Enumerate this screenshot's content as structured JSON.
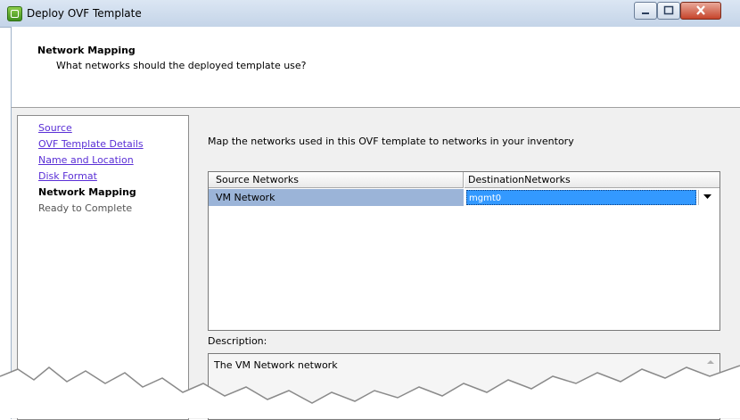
{
  "window": {
    "title": "Deploy OVF Template",
    "controls": [
      "minimize",
      "maximize",
      "close"
    ]
  },
  "header": {
    "title": "Network Mapping",
    "subtitle": "What networks should the deployed template use?"
  },
  "steps": [
    {
      "label": "Source",
      "state": "link"
    },
    {
      "label": "OVF Template Details",
      "state": "link"
    },
    {
      "label": "Name and Location",
      "state": "link"
    },
    {
      "label": "Disk Format",
      "state": "link"
    },
    {
      "label": "Network Mapping",
      "state": "current"
    },
    {
      "label": "Ready to Complete",
      "state": "pending"
    }
  ],
  "main": {
    "intro": "Map the networks used in this OVF template to networks in your inventory",
    "table": {
      "columns": [
        "Source Networks",
        "DestinationNetworks"
      ],
      "rows": [
        {
          "source": "VM Network",
          "destination": "mgmt0"
        }
      ]
    },
    "description_label": "Description:",
    "description_text": "The VM Network network"
  },
  "colors": {
    "selected_row": "#9bb4d8",
    "dropdown_selected": "#3399ff",
    "link": "#5a2fd6"
  }
}
